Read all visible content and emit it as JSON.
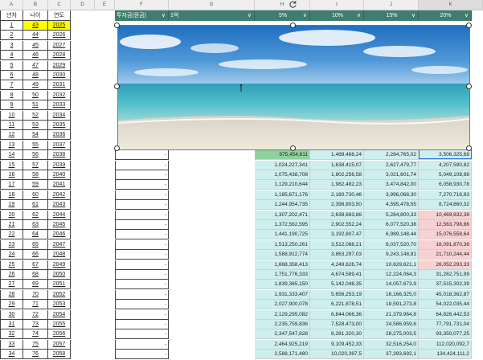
{
  "column_headers": [
    "A",
    "B",
    "C",
    "D",
    "E",
    "F",
    "G",
    "H",
    "I",
    "J",
    "K"
  ],
  "left_headers": [
    "년차",
    "나이",
    "연도"
  ],
  "filter_headers": {
    "f": "투자금(원금)",
    "g": "1억",
    "h": "5%",
    "i": "10%",
    "j": "15%",
    "k": "20%"
  },
  "dropdown_arrow": "∨",
  "colors": {
    "header_green": "#3f7d6f",
    "yellow_highlight": "#ffff00",
    "teal_fill": "#cfeeee",
    "green_cell": "#8fd19e",
    "pink_fill": "#f6d2d2",
    "selection_blue": "#2a6fd6"
  },
  "rows": [
    {
      "n": "1",
      "age": "43",
      "year": "2025"
    },
    {
      "n": "2",
      "age": "44",
      "year": "2026"
    },
    {
      "n": "3",
      "age": "45",
      "year": "2027"
    },
    {
      "n": "4",
      "age": "46",
      "year": "2028"
    },
    {
      "n": "5",
      "age": "47",
      "year": "2029"
    },
    {
      "n": "6",
      "age": "48",
      "year": "2030"
    },
    {
      "n": "7",
      "age": "49",
      "year": "2031"
    },
    {
      "n": "8",
      "age": "50",
      "year": "2032"
    },
    {
      "n": "9",
      "age": "51",
      "year": "2033"
    },
    {
      "n": "10",
      "age": "52",
      "year": "2034"
    },
    {
      "n": "11",
      "age": "53",
      "year": "2035"
    },
    {
      "n": "12",
      "age": "54",
      "year": "2036"
    },
    {
      "n": "13",
      "age": "55",
      "year": "2037"
    },
    {
      "n": "14",
      "age": "56",
      "year": "2038",
      "f": "-",
      "h": "975,454,611",
      "i": "1,489,468,24",
      "j": "2,284,765,02",
      "k": "3,506,325,68"
    },
    {
      "n": "15",
      "age": "57",
      "year": "2039",
      "f": "-",
      "h": "1,024,227,341",
      "i": "1,638,415,07",
      "j": "2,627,479,77",
      "k": "4,207,590,82"
    },
    {
      "n": "16",
      "age": "58",
      "year": "2040",
      "f": "-",
      "h": "1,075,438,708",
      "i": "1,802,256,58",
      "j": "3,021,601,74",
      "k": "5,049,108,98"
    },
    {
      "n": "17",
      "age": "59",
      "year": "2041",
      "f": "-",
      "h": "1,129,210,644",
      "i": "1,982,482,23",
      "j": "3,474,842,00",
      "k": "6,058,930,78"
    },
    {
      "n": "18",
      "age": "60",
      "year": "2042",
      "f": "-",
      "h": "1,185,671,176",
      "i": "2,180,730,46",
      "j": "3,996,068,30",
      "k": "7,270,716,93"
    },
    {
      "n": "19",
      "age": "61",
      "year": "2043",
      "f": "-",
      "h": "1,244,954,735",
      "i": "2,398,803,50",
      "j": "4,595,478,55",
      "k": "8,724,860,32"
    },
    {
      "n": "20",
      "age": "62",
      "year": "2044",
      "f": "-",
      "h": "1,307,202,471",
      "i": "2,638,683,86",
      "j": "5,284,800,33",
      "k": "10,469,832,38"
    },
    {
      "n": "21",
      "age": "63",
      "year": "2045",
      "f": "-",
      "h": "1,372,562,595",
      "i": "2,902,552,24",
      "j": "6,077,520,38",
      "k": "12,563,798,86"
    },
    {
      "n": "22",
      "age": "64",
      "year": "2046",
      "f": "-",
      "h": "1,441,190,725",
      "i": "3,192,807,47",
      "j": "6,989,148,44",
      "k": "15,076,558,64"
    },
    {
      "n": "23",
      "age": "65",
      "year": "2047",
      "f": "-",
      "h": "1,513,250,261",
      "i": "3,512,088,21",
      "j": "8,037,520,70",
      "k": "18,091,870,36"
    },
    {
      "n": "24",
      "age": "66",
      "year": "2048",
      "f": "-",
      "h": "1,588,912,774",
      "i": "3,863,297,03",
      "j": "9,243,148,81",
      "k": "21,710,244,44"
    },
    {
      "n": "25",
      "age": "67",
      "year": "2049",
      "f": "-",
      "h": "1,668,358,413",
      "i": "4,249,626,74",
      "j": "10,629,621,1",
      "k": "26,052,293,33"
    },
    {
      "n": "26",
      "age": "68",
      "year": "2050",
      "f": "-",
      "h": "1,751,776,333",
      "i": "4,674,589,41",
      "j": "12,224,064,3",
      "k": "31,262,751,99"
    },
    {
      "n": "27",
      "age": "69",
      "year": "2051",
      "f": "-",
      "h": "1,839,365,150",
      "i": "5,142,048,35",
      "j": "14,057,673,9",
      "k": "37,515,302,39"
    },
    {
      "n": "28",
      "age": "70",
      "year": "2052",
      "f": "-",
      "h": "1,931,333,407",
      "i": "5,656,253,19",
      "j": "16,166,325,0",
      "k": "45,018,362,87"
    },
    {
      "n": "29",
      "age": "71",
      "year": "2053",
      "f": "-",
      "h": "2,027,900,078",
      "i": "6,221,878,51",
      "j": "18,591,273,8",
      "k": "54,022,035,44"
    },
    {
      "n": "30",
      "age": "72",
      "year": "2054",
      "f": "-",
      "h": "2,129,295,082",
      "i": "6,844,066,36",
      "j": "21,379,964,8",
      "k": "64,826,442,53"
    },
    {
      "n": "31",
      "age": "73",
      "year": "2055",
      "f": "-",
      "h": "2,235,759,836",
      "i": "7,528,473,00",
      "j": "24,586,959,6",
      "k": "77,791,731,04"
    },
    {
      "n": "32",
      "age": "74",
      "year": "2056",
      "f": "-",
      "h": "2,347,547,828",
      "i": "8,281,320,30",
      "j": "28,275,003,5",
      "k": "93,350,077,25"
    },
    {
      "n": "33",
      "age": "75",
      "year": "2057",
      "f": "-",
      "h": "2,464,925,219",
      "i": "9,109,452,33",
      "j": "32,516,254,0",
      "k": "112,020,092,7"
    },
    {
      "n": "34",
      "age": "76",
      "year": "2058",
      "f": "-",
      "h": "2,588,171,480",
      "i": "10,020,397,5",
      "j": "37,393,692,1",
      "k": "134,424,111,2"
    }
  ]
}
